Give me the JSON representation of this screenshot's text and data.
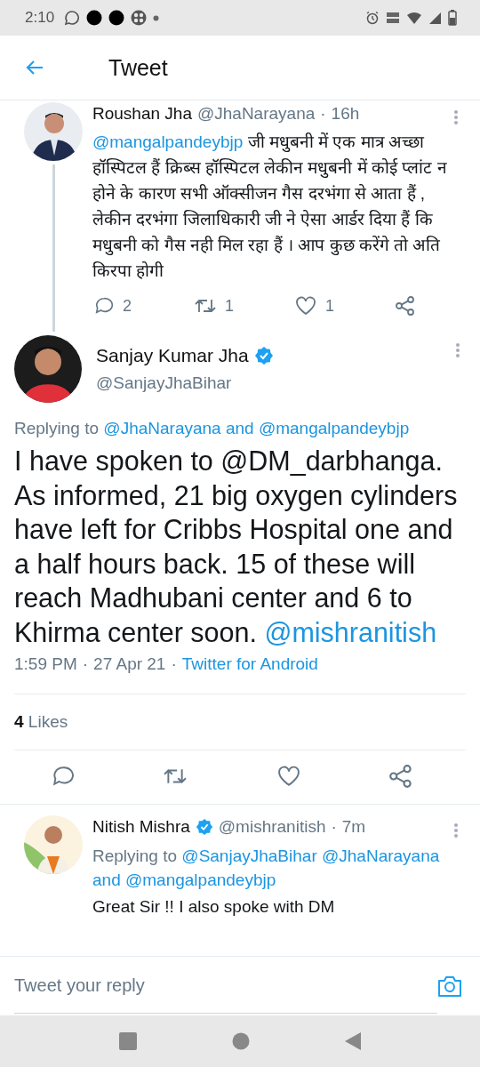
{
  "status_bar": {
    "time": "2:10"
  },
  "header": {
    "title": "Tweet"
  },
  "parent_tweet": {
    "name": "Roushan Jha",
    "handle": "@JhaNarayana",
    "separator": "·",
    "time": "16h",
    "parts": [
      {
        "kind": "mention",
        "text": "@mangalpandeybjp"
      },
      {
        "kind": "text",
        "text": " जी मधुबनी में एक मात्र अच्छा हॉस्पिटल हैं क्रिब्स हॉस्पिटल लेकीन मधुबनी में कोई प्लांट न होने के कारण सभी ऑक्सीजन गैस दरभंगा से आता हैं , लेकीन दरभंगा जिलाधिकारी जी ने ऐसा आर्डर दिया हैं कि मधुबनी को गैस नही मिल रहा हैं । आप कुछ करेंगे तो अति किरपा होगी"
      }
    ],
    "actions": [
      {
        "kind": "reply",
        "count": "2"
      },
      {
        "kind": "retweet",
        "count": "1"
      },
      {
        "kind": "like",
        "count": "1"
      },
      {
        "kind": "share"
      }
    ]
  },
  "main_tweet": {
    "name": "Sanjay Kumar Jha",
    "verified": true,
    "handle": "@SanjayJhaBihar",
    "replying": [
      {
        "kind": "text",
        "text": "Replying to "
      },
      {
        "kind": "mention",
        "text": "@JhaNarayana"
      },
      {
        "kind": "accent",
        "text": " and "
      },
      {
        "kind": "mention",
        "text": "@mangalpandeybjp"
      }
    ],
    "parts": [
      {
        "kind": "text",
        "text": "I have spoken to @DM_darbhanga. As informed, 21 big oxygen cylinders have left for Cribbs Hospital one and a half hours back. 15 of these will reach Madhubani center and 6 to Khirma center soon. "
      },
      {
        "kind": "mention",
        "text": "@mishranitish"
      }
    ],
    "time": "1:59 PM",
    "separator": "·",
    "date": "27 Apr 21",
    "source": "Twitter for Android",
    "likes": {
      "count": "4",
      "label": "Likes"
    },
    "actions": [
      {
        "kind": "reply"
      },
      {
        "kind": "retweet"
      },
      {
        "kind": "like"
      },
      {
        "kind": "share"
      }
    ]
  },
  "reply_tweet": {
    "name": "Nitish Mishra",
    "verified": true,
    "handle": "@mishranitish",
    "separator": "·",
    "time": "7m",
    "replying": [
      {
        "kind": "text",
        "text": "Replying to "
      },
      {
        "kind": "mention",
        "text": "@SanjayJhaBihar"
      },
      {
        "kind": "space"
      },
      {
        "kind": "mention",
        "text": "@JhaNarayana"
      },
      {
        "kind": "accent",
        "text": " and "
      },
      {
        "kind": "mention",
        "text": "@mangalpandeybjp"
      }
    ],
    "text": "Great Sir !! I also spoke with DM"
  },
  "compose": {
    "placeholder": "Tweet your reply"
  }
}
